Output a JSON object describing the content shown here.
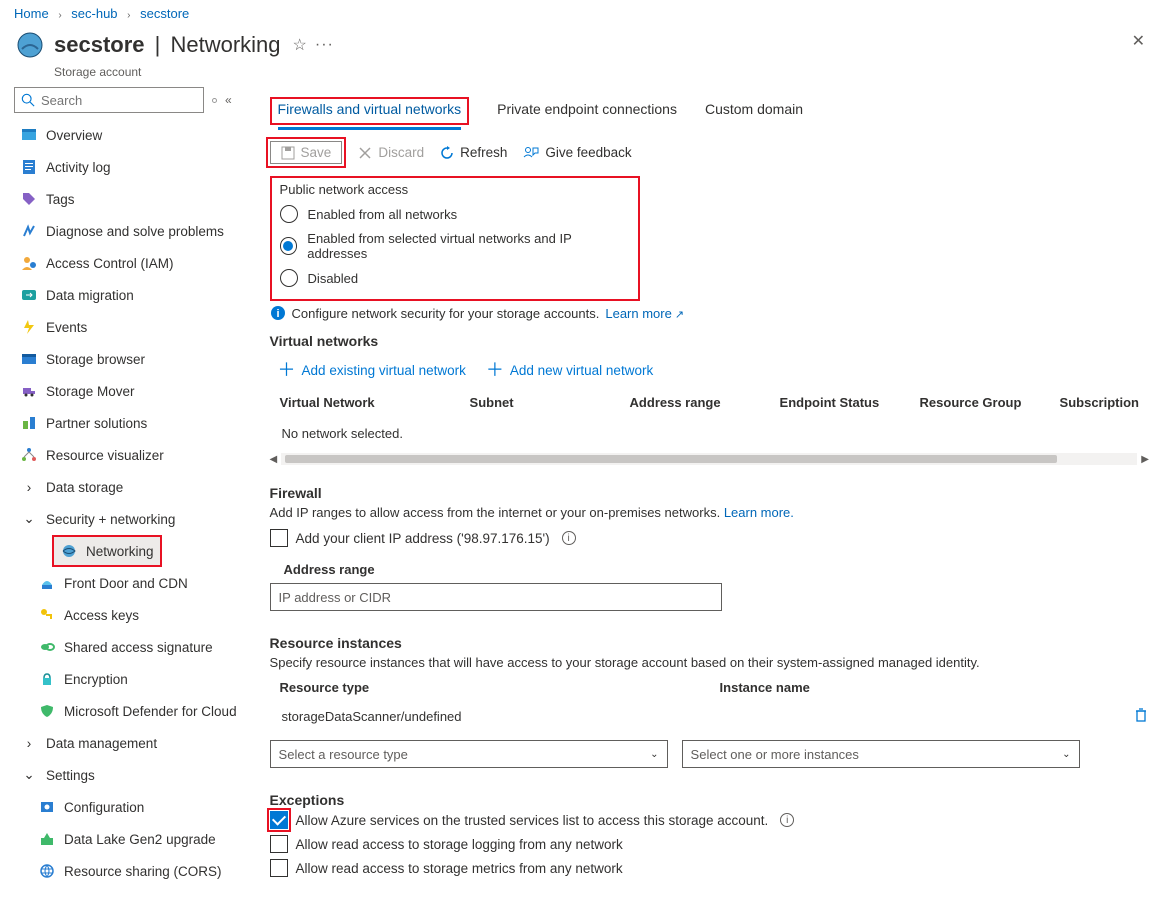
{
  "breadcrumb": {
    "home": "Home",
    "l1": "sec-hub",
    "l2": "secstore"
  },
  "header": {
    "name": "secstore",
    "section": "Networking",
    "subtitle": "Storage account"
  },
  "search": {
    "placeholder": "Search"
  },
  "nav": {
    "overview": "Overview",
    "activity": "Activity log",
    "tags": "Tags",
    "diagnose": "Diagnose and solve problems",
    "iam": "Access Control (IAM)",
    "migration": "Data migration",
    "events": "Events",
    "browser": "Storage browser",
    "mover": "Storage Mover",
    "partner": "Partner solutions",
    "visualizer": "Resource visualizer",
    "g_data": "Data storage",
    "g_sec": "Security + networking",
    "networking": "Networking",
    "frontdoor": "Front Door and CDN",
    "keys": "Access keys",
    "sas": "Shared access signature",
    "encryption": "Encryption",
    "defender": "Microsoft Defender for Cloud",
    "g_mgmt": "Data management",
    "g_settings": "Settings",
    "config": "Configuration",
    "gen2": "Data Lake Gen2 upgrade",
    "cors": "Resource sharing (CORS)"
  },
  "tabs": {
    "firewalls": "Firewalls and virtual networks",
    "pe": "Private endpoint connections",
    "domain": "Custom domain"
  },
  "toolbar": {
    "save": "Save",
    "discard": "Discard",
    "refresh": "Refresh",
    "feedback": "Give feedback"
  },
  "pna": {
    "title": "Public network access",
    "opt1": "Enabled from all networks",
    "opt2": "Enabled from selected virtual networks and IP addresses",
    "opt3": "Disabled"
  },
  "info": {
    "text": "Configure network security for your storage accounts.",
    "link": "Learn more"
  },
  "vnet": {
    "title": "Virtual networks",
    "add_existing": "Add existing virtual network",
    "add_new": "Add new virtual network",
    "cols": {
      "c1": "Virtual Network",
      "c2": "Subnet",
      "c3": "Address range",
      "c4": "Endpoint Status",
      "c5": "Resource Group",
      "c6": "Subscription"
    },
    "empty": "No network selected."
  },
  "firewall": {
    "title": "Firewall",
    "desc": "Add IP ranges to allow access from the internet or your on-premises networks.",
    "learn": "Learn more.",
    "client_ip": "Add your client IP address ('98.97.176.15')",
    "range_label": "Address range",
    "range_placeholder": "IP address or CIDR"
  },
  "ri": {
    "title": "Resource instances",
    "desc": "Specify resource instances that will have access to your storage account based on their system-assigned managed identity.",
    "col1": "Resource type",
    "col2": "Instance name",
    "row": "storageDataScanner/undefined",
    "sel1": "Select a resource type",
    "sel2": "Select one or more instances"
  },
  "exc": {
    "title": "Exceptions",
    "e1": "Allow Azure services on the trusted services list to access this storage account.",
    "e2": "Allow read access to storage logging from any network",
    "e3": "Allow read access to storage metrics from any network"
  }
}
